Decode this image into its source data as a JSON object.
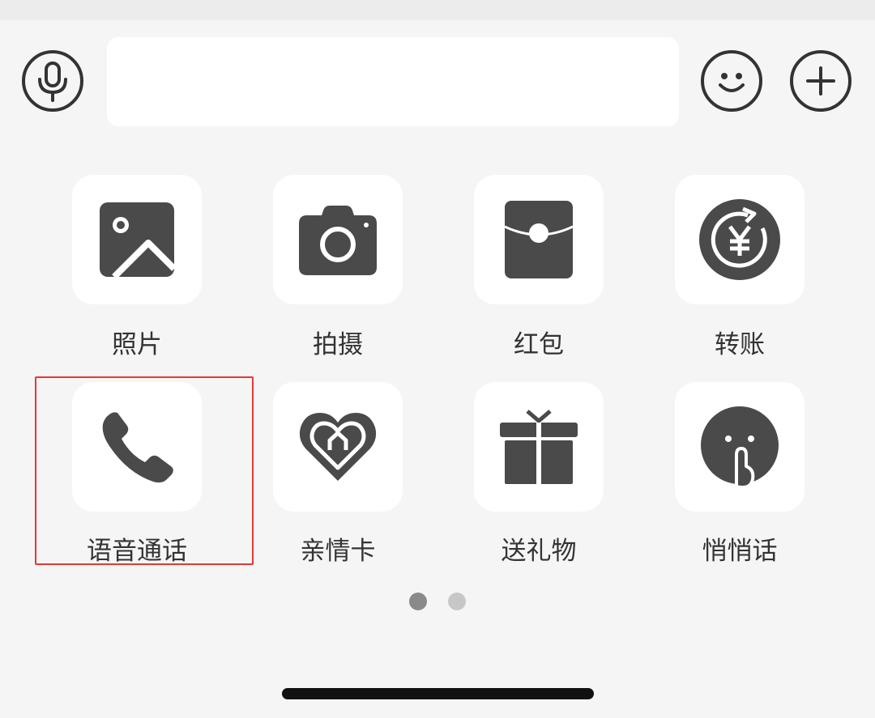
{
  "input_bar": {
    "voice_icon": "microphone-icon",
    "input_value": "",
    "input_placeholder": "",
    "emoji_icon": "smiley-icon",
    "more_icon": "plus-icon"
  },
  "panel": {
    "items": [
      {
        "label": "照片",
        "icon": "photo-icon"
      },
      {
        "label": "拍摄",
        "icon": "camera-icon"
      },
      {
        "label": "红包",
        "icon": "red-packet-icon"
      },
      {
        "label": "转账",
        "icon": "transfer-icon"
      },
      {
        "label": "语音通话",
        "icon": "phone-icon"
      },
      {
        "label": "亲情卡",
        "icon": "family-card-icon"
      },
      {
        "label": "送礼物",
        "icon": "gift-icon"
      },
      {
        "label": "悄悄话",
        "icon": "whisper-icon"
      }
    ],
    "highlighted_item": "语音通话"
  },
  "pagination": {
    "current_page": 1,
    "total_pages": 2
  },
  "colors": {
    "background": "#f5f5f5",
    "tile_background": "#ffffff",
    "icon": "#4a4a4a",
    "highlight_border": "#e53935",
    "dot_active": "#8a8a8a",
    "dot_inactive": "#c7c7c7"
  }
}
